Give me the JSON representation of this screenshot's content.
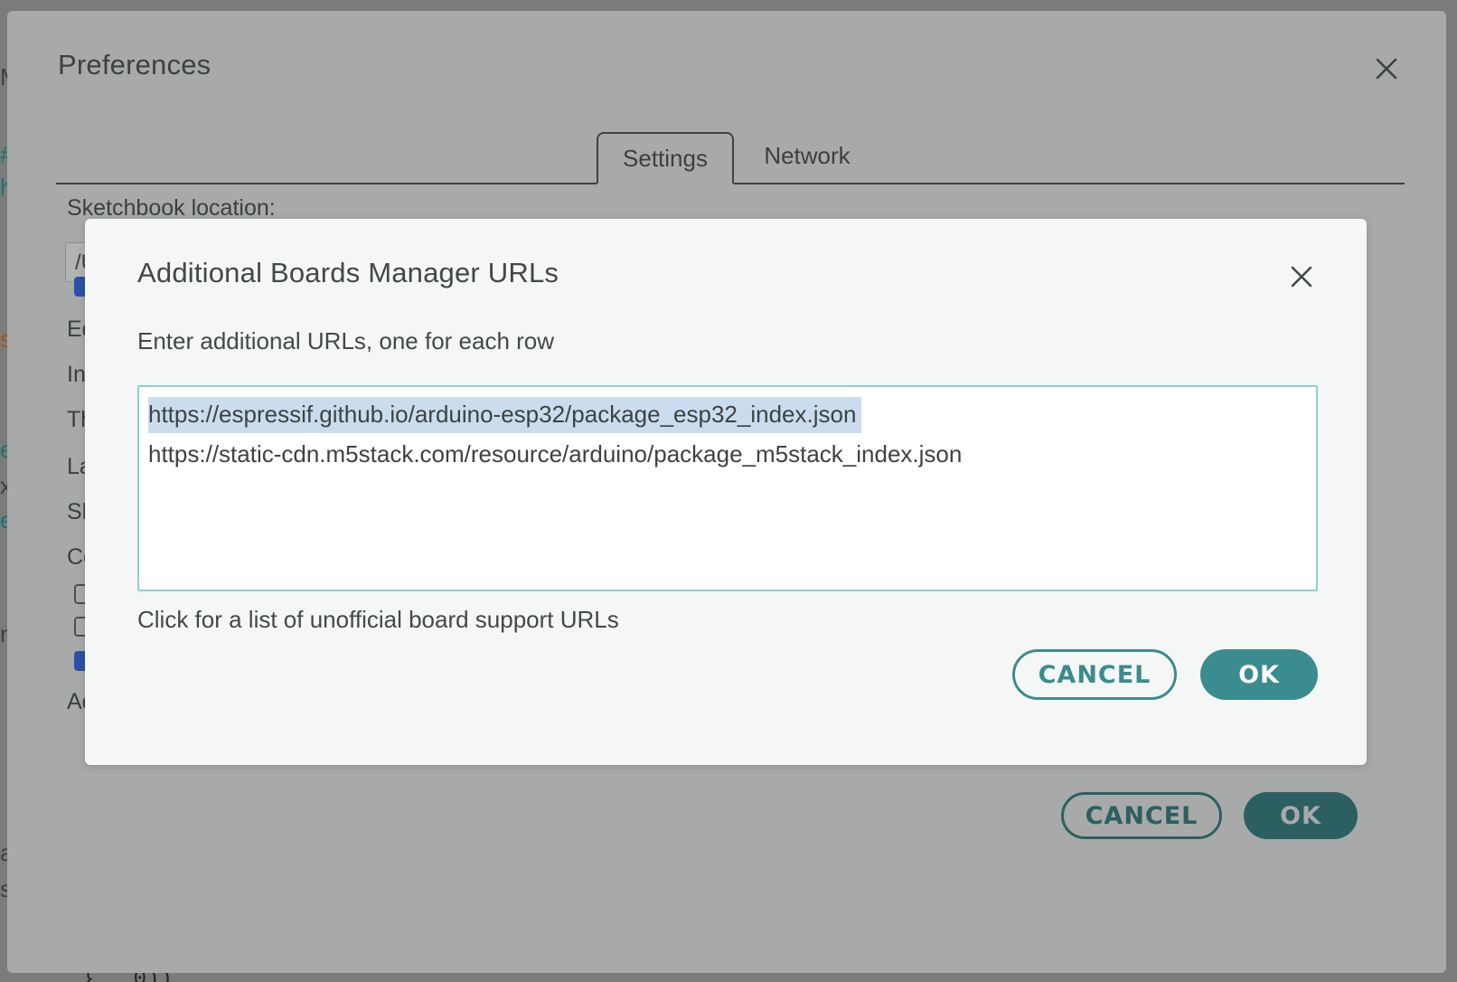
{
  "background": {
    "fragments": [
      "M",
      "#",
      "h",
      "s",
      "e",
      "x",
      "e",
      "n",
      "a",
      "s"
    ],
    "code_bottom": "} … 0))"
  },
  "preferences": {
    "title": "Preferences",
    "tabs": [
      {
        "label": "Settings",
        "active": true
      },
      {
        "label": "Network",
        "active": false
      }
    ],
    "sketchbook_label": "Sketchbook location:",
    "sketchbook_value_partial": "/U",
    "partial_labels": [
      "Ed",
      "In",
      "Th",
      "La",
      "Sh",
      "Co",
      "Ad"
    ],
    "cancel_label": "CANCEL",
    "ok_label": "OK"
  },
  "modal": {
    "title": "Additional Boards Manager URLs",
    "description": "Enter additional URLs, one for each row",
    "urls": [
      "https://espressif.github.io/arduino-esp32/package_esp32_index.json",
      "https://static-cdn.m5stack.com/resource/arduino/package_m5stack_index.json"
    ],
    "link_text": "Click for a list of unofficial board support URLs",
    "cancel_label": "CANCEL",
    "ok_label": "OK"
  },
  "colors": {
    "accent_teal": "#3b8c8f",
    "dark_teal": "#2c5f62",
    "selection": "#cbdcef",
    "checkbox_blue": "#2c51a8"
  }
}
